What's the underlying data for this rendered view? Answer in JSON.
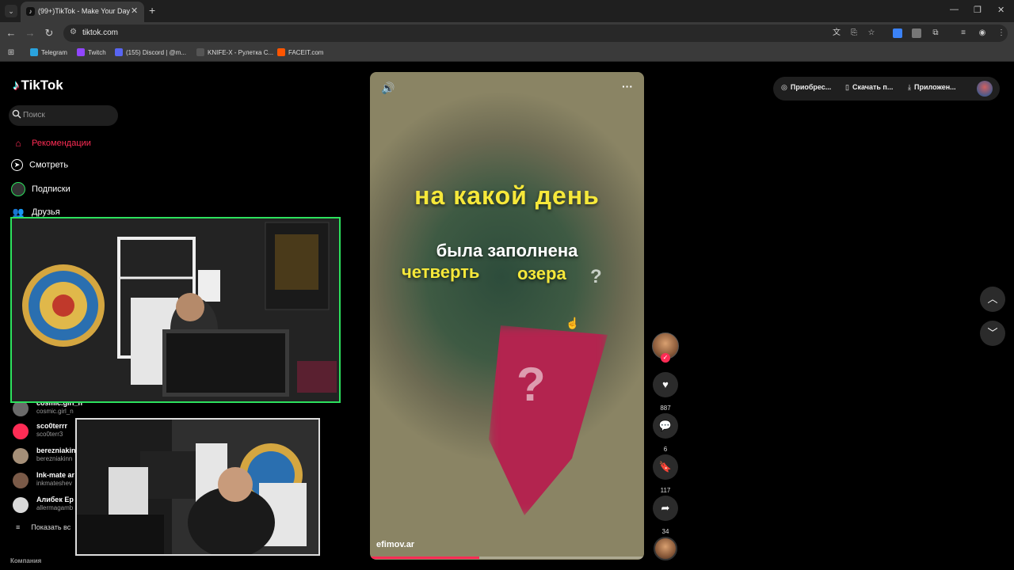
{
  "browser": {
    "tab_title": "(99+)TikTok - Make Your Day",
    "url": "tiktok.com",
    "bookmarks": [
      {
        "label": "Telegram",
        "color": "#2aa3de"
      },
      {
        "label": "Twitch",
        "color": "#9146ff"
      },
      {
        "label": "(155) Discord | @m...",
        "color": "#5865f2"
      },
      {
        "label": "KNIFE-X - Рулетка С...",
        "color": "#555555"
      },
      {
        "label": "FACEIT.com",
        "color": "#ff5500"
      }
    ]
  },
  "tiktok": {
    "logo": "TikTok",
    "search_placeholder": "Поиск",
    "nav": [
      {
        "label": "Рекомендации",
        "icon": "home-icon"
      },
      {
        "label": "Смотреть",
        "icon": "compass-icon"
      },
      {
        "label": "Подписки",
        "icon": "following-icon"
      },
      {
        "label": "Друзья",
        "icon": "friends-icon"
      }
    ],
    "accounts": [
      {
        "name": "cosmic.girl_n",
        "handle": "cosmic.girl_n"
      },
      {
        "name": "sco0terrr",
        "handle": "sco0terr3"
      },
      {
        "name": "berezniakin",
        "handle": "berezniakinn"
      },
      {
        "name": "Ink-mate ar",
        "handle": "inkmateshev"
      },
      {
        "name": "Алибек Ер",
        "handle": "allermagamb"
      }
    ],
    "show_all": "Показать вс",
    "company": "Компания",
    "top_actions": {
      "buy": "Приобрес...",
      "download": "Скачать п...",
      "app": "Приложен..."
    }
  },
  "video": {
    "line1": "на какой день",
    "line2": "была заполнена",
    "line3": "четверть",
    "line4": "озера",
    "question": "?",
    "author": "efimov.ar",
    "progress": 0.4,
    "likes": "887",
    "comments": "6",
    "saves": "117",
    "shares": "34"
  },
  "colors": {
    "brand": "#fe2c55",
    "caption_yellow": "#f6e83a",
    "cam_border": "#2ce15d"
  }
}
